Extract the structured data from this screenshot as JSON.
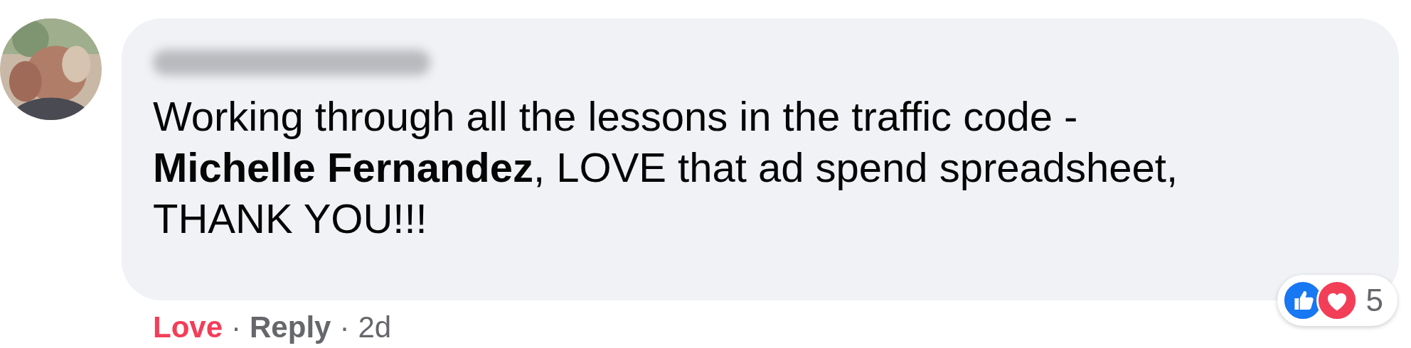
{
  "comment": {
    "text": "Working through all the lessons in the traffic code - **Michelle Fernandez**, LOVE that ad spend spreadsheet, THANK YOU!!!",
    "reactions": {
      "icons": [
        {
          "kind": "like"
        },
        {
          "kind": "love"
        }
      ],
      "count": "5"
    }
  },
  "actions": [
    {
      "kind": "reaction",
      "label": "Love",
      "selected": true
    },
    {
      "kind": "separator",
      "label": "·"
    },
    {
      "kind": "link",
      "label": "Reply"
    },
    {
      "kind": "separator",
      "label": "·"
    },
    {
      "kind": "time",
      "label": "2d"
    }
  ]
}
